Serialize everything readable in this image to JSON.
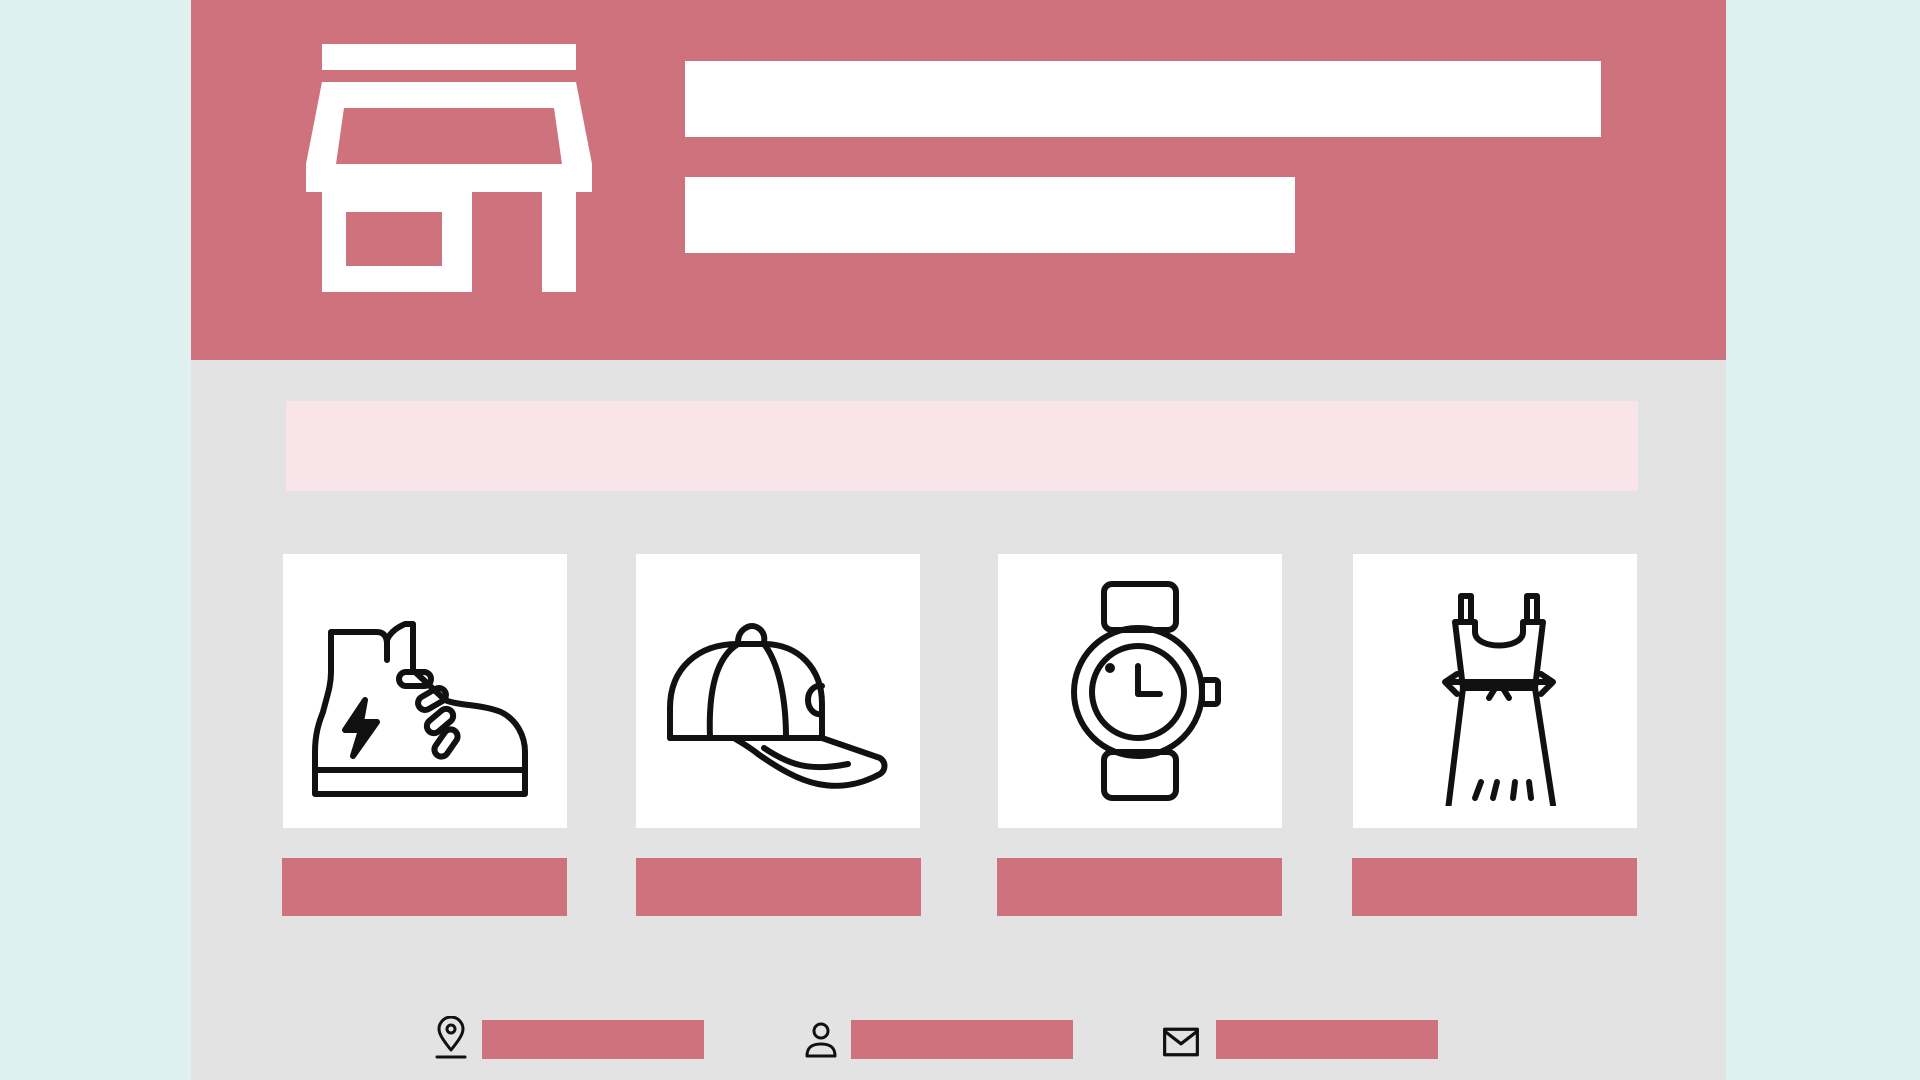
{
  "header": {
    "logo_icon": "storefront-icon",
    "title": "",
    "subtitle": ""
  },
  "banner": {
    "text": ""
  },
  "products": [
    {
      "icon": "sneaker-icon",
      "button_label": ""
    },
    {
      "icon": "baseball-cap-icon",
      "button_label": ""
    },
    {
      "icon": "wristwatch-icon",
      "button_label": ""
    },
    {
      "icon": "dress-icon",
      "button_label": ""
    }
  ],
  "contact": [
    {
      "icon": "location-pin-icon",
      "text": ""
    },
    {
      "icon": "user-icon",
      "text": ""
    },
    {
      "icon": "envelope-icon",
      "text": ""
    }
  ],
  "colors": {
    "background": "#dff0f1",
    "page": "#e3e3e3",
    "accent": "#ce737d",
    "banner": "#f9e4ea",
    "card": "#ffffff",
    "icon_stroke": "#111111"
  }
}
